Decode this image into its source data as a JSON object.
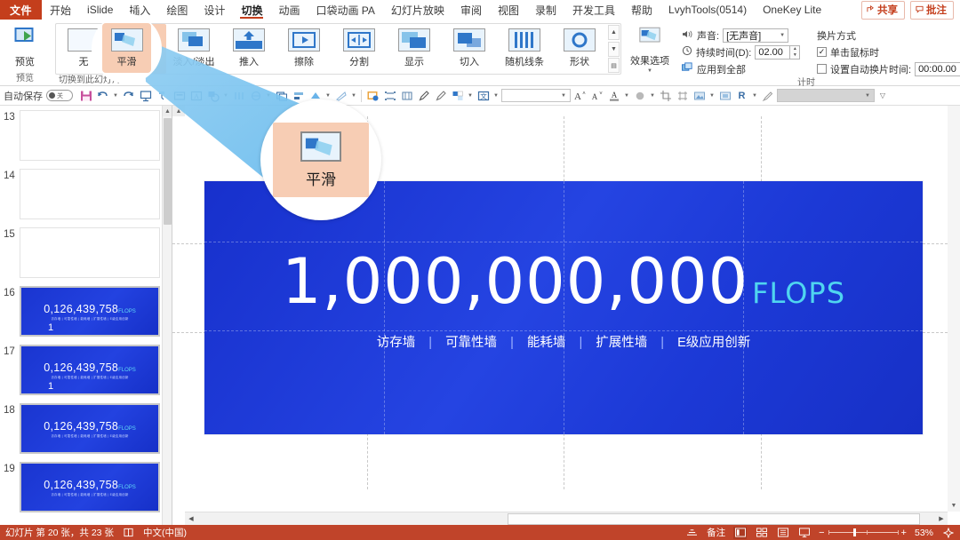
{
  "app": {
    "menu": {
      "file_label": "文件",
      "items": [
        {
          "label": "开始"
        },
        {
          "label": "iSlide"
        },
        {
          "label": "插入"
        },
        {
          "label": "绘图"
        },
        {
          "label": "设计"
        },
        {
          "label": "切换",
          "active": true
        },
        {
          "label": "动画"
        },
        {
          "label": "口袋动画 PA"
        },
        {
          "label": "幻灯片放映"
        },
        {
          "label": "审阅"
        },
        {
          "label": "视图"
        },
        {
          "label": "录制"
        },
        {
          "label": "开发工具"
        },
        {
          "label": "帮助"
        },
        {
          "label": "LvyhTools(0514)"
        },
        {
          "label": "OneKey Lite"
        }
      ],
      "share_label": "共享",
      "comment_label": "批注"
    },
    "ribbon": {
      "preview_group": {
        "button_label": "预览",
        "group_label": "预览"
      },
      "transition_group": {
        "group_label": "切换到此幻灯片",
        "items": [
          {
            "label": "无",
            "icon": "none-transition-icon",
            "selected": false
          },
          {
            "label": "平滑",
            "icon": "morph-transition-icon",
            "selected": true
          },
          {
            "label": "淡入/淡出",
            "icon": "fade-transition-icon",
            "selected": false
          },
          {
            "label": "推入",
            "icon": "push-transition-icon",
            "selected": false
          },
          {
            "label": "擦除",
            "icon": "wipe-transition-icon",
            "selected": false
          },
          {
            "label": "分割",
            "icon": "split-transition-icon",
            "selected": false
          },
          {
            "label": "显示",
            "icon": "reveal-transition-icon",
            "selected": false
          },
          {
            "label": "切入",
            "icon": "cut-transition-icon",
            "selected": false
          },
          {
            "label": "随机线条",
            "icon": "random-bars-transition-icon",
            "selected": false
          },
          {
            "label": "形状",
            "icon": "shape-transition-icon",
            "selected": false
          }
        ],
        "effect_options_label": "效果选项"
      },
      "timing_group": {
        "group_label": "计时",
        "sound_label": "声音:",
        "sound_value": "[无声音]",
        "duration_label": "持续时间(D):",
        "duration_value": "02.00",
        "apply_all_label": "应用到全部",
        "advance_label": "换片方式",
        "on_click_label": "单击鼠标时",
        "on_click_checked": true,
        "auto_after_label": "设置自动换片时间:",
        "auto_after_checked": false,
        "auto_after_value": "00:00.00"
      }
    },
    "qat": {
      "autosave_label": "自动保存",
      "autosave_state": "关",
      "icons": [
        "save-icon",
        "undo-icon",
        "redo-icon",
        "present-icon",
        "format-painter-icon",
        "shape-fill-icon",
        "text-box-icon",
        "shapes-icon",
        "columns-icon",
        "link-icon",
        "duplicate-icon",
        "align-icon",
        "shape-outline-icon",
        "eyedropper-icon",
        "picture-insert-icon",
        "group-icon",
        "merge-icon",
        "pen-icon",
        "highlighter-icon",
        "gradient-icon",
        "text-effect-icon"
      ],
      "font_size_field": "",
      "style_field": ""
    },
    "thumbnails": [
      {
        "number": "13",
        "blank": true
      },
      {
        "number": "14",
        "blank": true
      },
      {
        "number": "15",
        "blank": true
      },
      {
        "number": "16",
        "blank": false,
        "number_text": "0,126,439,758",
        "unit": "FLOPS",
        "sub": "访存墙 | 可靠性墙 | 能耗墙 | 扩展性墙 | E级应用创新",
        "corner": "1"
      },
      {
        "number": "17",
        "blank": false,
        "number_text": "0,126,439,758",
        "unit": "FLOPS",
        "sub": "访存墙 | 可靠性墙 | 能耗墙 | 扩展性墙 | E级应用创新",
        "corner": "1"
      },
      {
        "number": "18",
        "blank": false,
        "number_text": "0,126,439,758",
        "unit": "FLOPS",
        "sub": "访存墙 | 可靠性墙 | 能耗墙 | 扩展性墙 | E级应用创新",
        "corner": ""
      },
      {
        "number": "19",
        "blank": false,
        "number_text": "0,126,439,758",
        "unit": "FLOPS",
        "sub": "访存墙 | 可靠性墙 | 能耗墙 | 扩展性墙 | E级应用创新",
        "corner": ""
      }
    ],
    "slide": {
      "big_number": "1,000,000,000",
      "unit": "FLOPS",
      "sub_items": [
        "访存墙",
        "可靠性墙",
        "能耗墙",
        "扩展性墙",
        "E级应用创新"
      ],
      "background_color": "#1a35d0",
      "unit_color": "#4fd5f0"
    },
    "magnifier": {
      "label": "平滑",
      "icon": "morph-transition-icon"
    },
    "statusbar": {
      "slide_info": "幻灯片 第 20 张，共 23 张",
      "language": "中文(中国)",
      "notes_label": "备注",
      "zoom_value": "53%",
      "zoom_out": "−",
      "zoom_in": "+",
      "views": [
        "normal-view-icon",
        "slide-sorter-icon",
        "reading-view-icon",
        "slideshow-icon"
      ],
      "fit_icon": "fit-slide-icon"
    },
    "colors": {
      "accent_red": "#c43e1c",
      "status_bar": "#c0442a",
      "selection_peach": "#f7cdb4",
      "magnifier_blue": "#6cc0ef"
    }
  }
}
